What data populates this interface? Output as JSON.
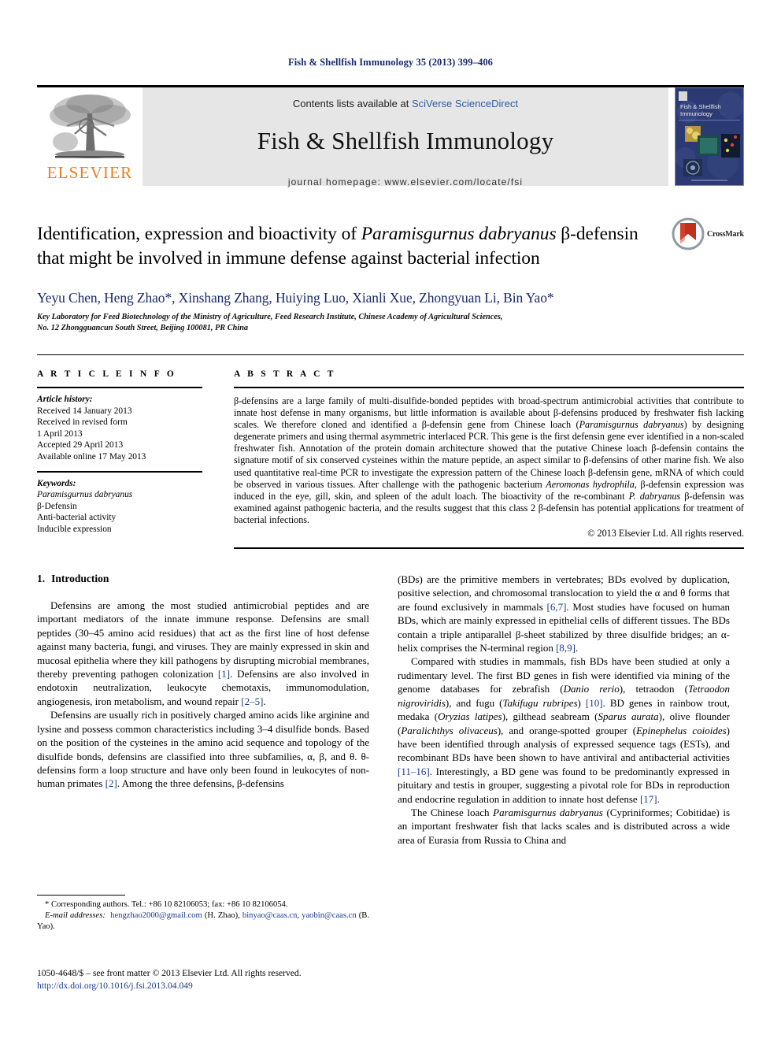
{
  "running_head": "Fish & Shellfish Immunology 35 (2013) 399–406",
  "masthead": {
    "publisher_logo_text": "ELSEVIER",
    "contents_prefix": "Contents lists available at ",
    "contents_link": "SciVerse ScienceDirect",
    "journal_title": "Fish & Shellfish Immunology",
    "homepage": "journal homepage: www.elsevier.com/locate/fsi",
    "cover_title_line1": "Fish & Shellfish",
    "cover_title_line2": "Immunology"
  },
  "article": {
    "title_part1": "Identification, expression and bioactivity of ",
    "title_italic": "Paramisgurnus dabryanus",
    "title_part2": " β-defensin that might be involved in immune defense against bacterial infection",
    "crossmark_label": "CrossMark",
    "authors": "Yeyu Chen, Heng Zhao*, Xinshang Zhang, Huiying Luo, Xianli Xue, Zhongyuan Li, Bin Yao*",
    "affiliation_line1": "Key Laboratory for Feed Biotechnology of the Ministry of Agriculture, Feed Research Institute, Chinese Academy of Agricultural Sciences,",
    "affiliation_line2": "No. 12 Zhongguancun South Street, Beijing 100081, PR China"
  },
  "article_info": {
    "heading": "A R T I C L E   I N F O",
    "history_label": "Article history:",
    "history": [
      "Received 14 January 2013",
      "Received in revised form",
      "1 April 2013",
      "Accepted 29 April 2013",
      "Available online 17 May 2013"
    ],
    "keywords_label": "Keywords:",
    "keywords": [
      "Paramisgurnus dabryanus",
      "β-Defensin",
      "Anti-bacterial activity",
      "Inducible expression"
    ]
  },
  "abstract": {
    "heading": "A B S T R A C T",
    "text_1": "β-defensins are a large family of multi-disulfide-bonded peptides with broad-spectrum antimicrobial activities that contribute to innate host defense in many organisms, but little information is available about β-defensins produced by freshwater fish lacking scales. We therefore cloned and identified a β-defensin gene from Chinese loach (",
    "species_1": "Paramisgurnus dabryanus",
    "text_2": ") by designing degenerate primers and using thermal asymmetric interlaced PCR. This gene is the first defensin gene ever identified in a non-scaled freshwater fish. Annotation of the protein domain architecture showed that the putative Chinese loach β-defensin contains the signature motif of six conserved cysteines within the mature peptide, an aspect similar to β-defensins of other marine fish. We also used quantitative real-time PCR to investigate the expression pattern of the Chinese loach β-defensin gene, mRNA of which could be observed in various tissues. After challenge with the pathogenic bacterium ",
    "species_2": "Aeromonas hydrophila",
    "text_3": ", β-defensin expression was induced in the eye, gill, skin, and spleen of the adult loach. The bioactivity of the re-combinant ",
    "species_3": "P. dabryanus",
    "text_4": " β-defensin was examined against pathogenic bacteria, and the results suggest that this class 2 β-defensin has potential applications for treatment of bacterial infections.",
    "copyright": "© 2013 Elsevier Ltd. All rights reserved."
  },
  "introduction": {
    "number": "1.",
    "title": "Introduction",
    "p1_a": "Defensins are among the most studied antimicrobial peptides and are important mediators of the innate immune response. Defensins are small peptides (30–45 amino acid residues) that act as the first line of host defense against many bacteria, fungi, and viruses. They are mainly expressed in skin and mucosal epithelia where they kill pathogens by disrupting microbial membranes, thereby preventing pathogen colonization ",
    "p1_ref1": "[1]",
    "p1_b": ". Defensins are also involved in endotoxin neutralization, leukocyte chemotaxis, immunomodulation, angiogenesis, iron metabolism, and wound repair ",
    "p1_ref2": "[2–5]",
    "p1_c": ".",
    "p2_a": "Defensins are usually rich in positively charged amino acids like arginine and lysine and possess common characteristics including 3–4 disulfide bonds. Based on the position of the cysteines in the amino acid sequence and topology of the disulfide bonds, defensins are classified into three subfamilies, α, β, and θ. θ-defensins form a loop structure and have only been found in leukocytes of non-human primates ",
    "p2_ref1": "[2]",
    "p2_b": ". Among the three defensins, β-defensins",
    "p3_a": "(BDs) are the primitive members in vertebrates; BDs evolved by duplication, positive selection, and chromosomal translocation to yield the α and θ forms that are found exclusively in mammals ",
    "p3_ref1": "[6,7]",
    "p3_b": ". Most studies have focused on human BDs, which are mainly expressed in epithelial cells of different tissues. The BDs contain a triple antiparallel β-sheet stabilized by three disulfide bridges; an α-helix comprises the N-terminal region ",
    "p3_ref2": "[8,9]",
    "p3_c": ".",
    "p4_a": "Compared with studies in mammals, fish BDs have been studied at only a rudimentary level. The first BD genes in fish were identified via mining of the genome databases for zebrafish (",
    "p4_sp1": "Danio rerio",
    "p4_b": "), tetraodon (",
    "p4_sp2": "Tetraodon nigroviridis",
    "p4_c": "), and fugu (",
    "p4_sp3": "Takifugu rubripes",
    "p4_d": ") ",
    "p4_ref1": "[10]",
    "p4_e": ". BD genes in rainbow trout, medaka (",
    "p4_sp4": "Oryzias latipes",
    "p4_f": "), gilthead seabream (",
    "p4_sp5": "Sparus aurata",
    "p4_g": "), olive flounder (",
    "p4_sp6": "Paralichthys olivaceus",
    "p4_h": "), and orange-spotted grouper (",
    "p4_sp7": "Epinephelus coioides",
    "p4_i": ") have been identified through analysis of expressed sequence tags (ESTs), and recombinant BDs have been shown to have antiviral and antibacterial activities ",
    "p4_ref2": "[11–16]",
    "p4_j": ". Interestingly, a BD gene was found to be predominantly expressed in pituitary and testis in grouper, suggesting a pivotal role for BDs in reproduction and endocrine regulation in addition to innate host defense ",
    "p4_ref3": "[17]",
    "p4_k": ".",
    "p5_a": "The Chinese loach ",
    "p5_sp1": "Paramisgurnus dabryanus",
    "p5_b": " (Cypriniformes; Cobitidae) is an important freshwater fish that lacks scales and is distributed across a wide area of Eurasia from Russia to China and"
  },
  "footnotes": {
    "corresponding": "* Corresponding authors. Tel.: +86 10 82106053; fax: +86 10 82106054.",
    "email_label": "E-mail addresses:",
    "email_1": "hengzhao2000@gmail.com",
    "email_1_who": " (H. Zhao), ",
    "email_2": "binyao@caas.cn",
    "email_2_sep": ", ",
    "email_3": "yaobin@caas.cn",
    "email_3_who": " (B. Yao)."
  },
  "issn": {
    "line": "1050-4648/$ – see front matter © 2013 Elsevier Ltd. All rights reserved.",
    "doi": "http://dx.doi.org/10.1016/j.fsi.2013.04.049"
  },
  "colors": {
    "link_blue": "#2b5fa7",
    "ref_blue": "#1a3a8f",
    "author_blue": "#1a2a6c",
    "elsevier_orange": "#ef7f1a",
    "band_gray": "#e6e6e6",
    "cover_navy": "#2b3a73",
    "crossmark_red": "#c0301c"
  }
}
